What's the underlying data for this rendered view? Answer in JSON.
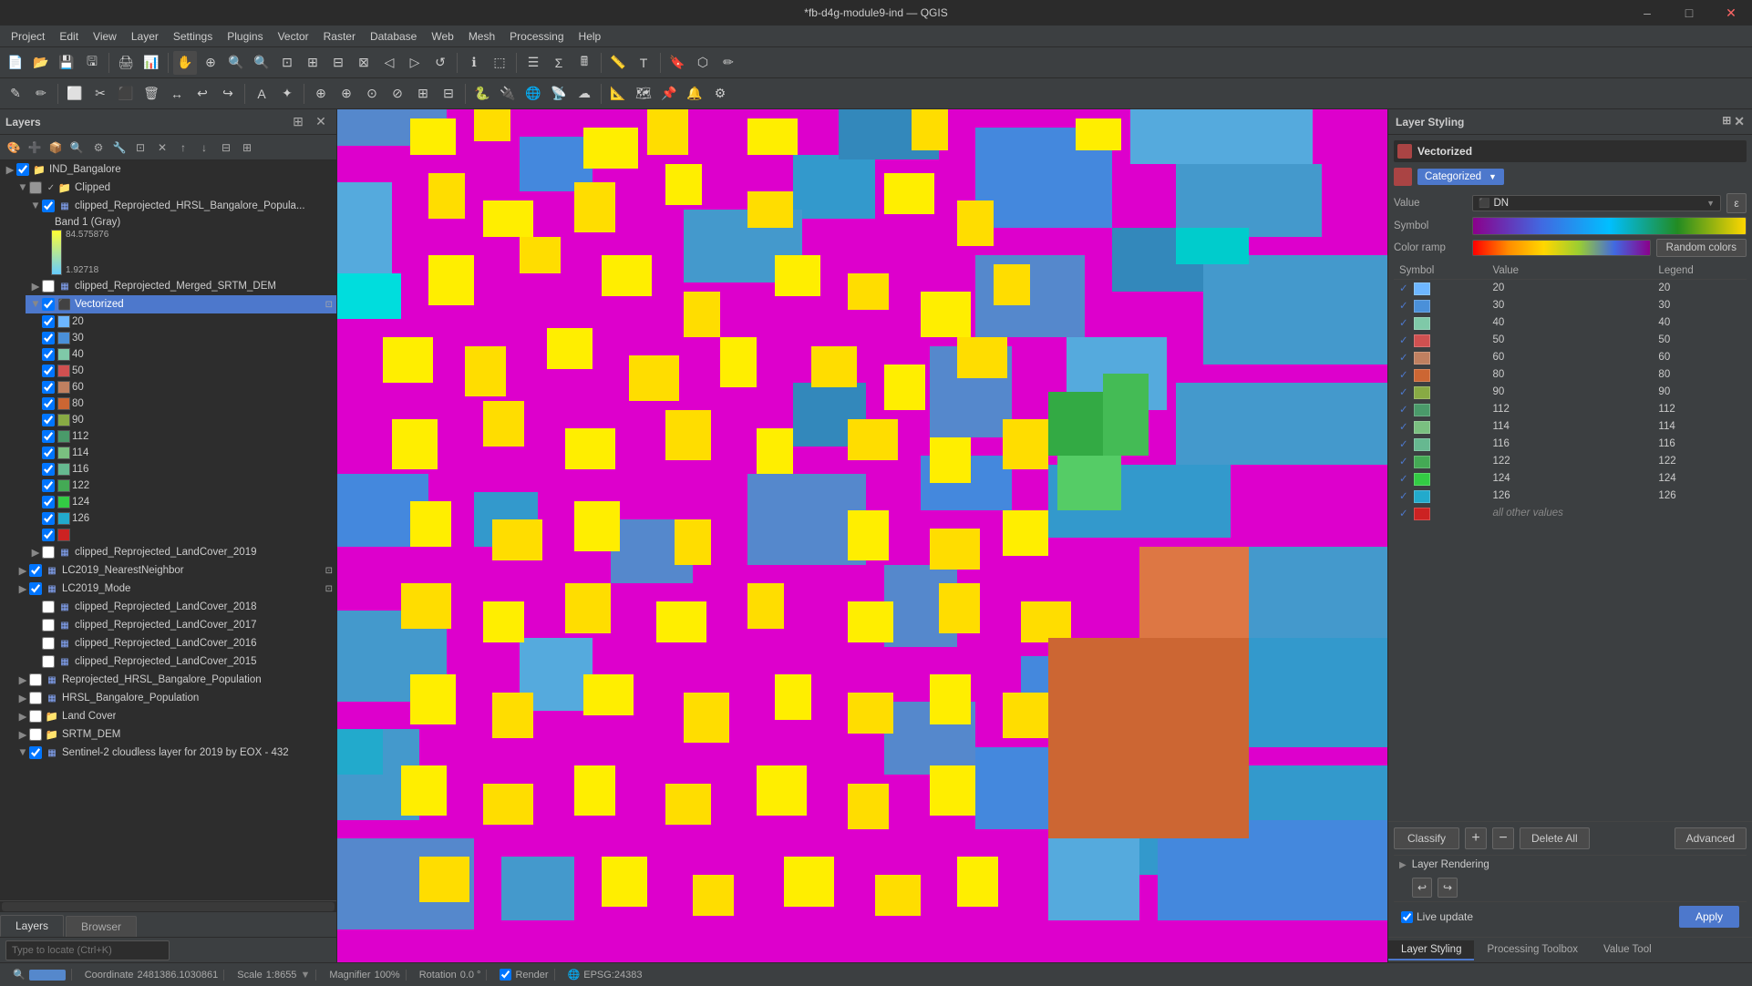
{
  "titlebar": {
    "title": "*fb-d4g-module9-ind — QGIS",
    "min": "–",
    "max": "□",
    "close": "✕"
  },
  "menubar": {
    "items": [
      "Project",
      "Edit",
      "View",
      "Layer",
      "Settings",
      "Plugins",
      "Vector",
      "Raster",
      "Database",
      "Web",
      "Mesh",
      "Processing",
      "Help"
    ]
  },
  "panels": {
    "layers": "Layers",
    "layer_styling": "Layer Styling"
  },
  "layers_panel": {
    "search_placeholder": "Type to locate (Ctrl+K)"
  },
  "layers": [
    {
      "id": "ind_bangalore",
      "name": "IND_Bangalore",
      "checked": true,
      "indent": 0,
      "type": "group",
      "expanded": false
    },
    {
      "id": "clipped",
      "name": "Clipped",
      "checked": true,
      "indent": 1,
      "type": "group",
      "expanded": true
    },
    {
      "id": "clipped_hrsl",
      "name": "clipped_Reprojected_HRSL_Bangalore_Popula...",
      "checked": true,
      "indent": 2,
      "type": "raster",
      "expanded": true
    },
    {
      "id": "band1",
      "name": "Band 1 (Gray)",
      "checked": false,
      "indent": 3,
      "type": "legend"
    },
    {
      "id": "clipped_srtm",
      "name": "clipped_Reprojected_Merged_SRTM_DEM",
      "checked": false,
      "indent": 2,
      "type": "raster",
      "expanded": false
    },
    {
      "id": "vectorized",
      "name": "Vectorized",
      "checked": true,
      "indent": 2,
      "type": "vector",
      "selected": true
    },
    {
      "id": "val20",
      "name": "20",
      "checked": true,
      "indent": 3,
      "type": "legend_item",
      "color": "#6db6ff"
    },
    {
      "id": "val30",
      "name": "30",
      "checked": true,
      "indent": 3,
      "type": "legend_item",
      "color": "#4a90d9"
    },
    {
      "id": "val40",
      "name": "40",
      "checked": true,
      "indent": 3,
      "type": "legend_item",
      "color": "#7fc9a8"
    },
    {
      "id": "val50",
      "name": "50",
      "checked": true,
      "indent": 3,
      "type": "legend_item",
      "color": "#d05050"
    },
    {
      "id": "val60",
      "name": "60",
      "checked": true,
      "indent": 3,
      "type": "legend_item",
      "color": "#c08060"
    },
    {
      "id": "val80",
      "name": "80",
      "checked": true,
      "indent": 3,
      "type": "legend_item",
      "color": "#cc6633"
    },
    {
      "id": "val90",
      "name": "90",
      "checked": true,
      "indent": 3,
      "type": "legend_item",
      "color": "#88aa44"
    },
    {
      "id": "val112",
      "name": "112",
      "checked": true,
      "indent": 3,
      "type": "legend_item",
      "color": "#4a9a6a"
    },
    {
      "id": "val114",
      "name": "114",
      "checked": true,
      "indent": 3,
      "type": "legend_item",
      "color": "#7ac080"
    },
    {
      "id": "val116",
      "name": "116",
      "checked": true,
      "indent": 3,
      "type": "legend_item",
      "color": "#66b890"
    },
    {
      "id": "val122",
      "name": "122",
      "checked": true,
      "indent": 3,
      "type": "legend_item",
      "color": "#44aa55"
    },
    {
      "id": "val124",
      "name": "124",
      "checked": true,
      "indent": 3,
      "type": "legend_item",
      "color": "#33cc44"
    },
    {
      "id": "val126",
      "name": "126",
      "checked": true,
      "indent": 3,
      "type": "legend_item",
      "color": "#22aacc"
    },
    {
      "id": "val_other",
      "name": "",
      "checked": true,
      "indent": 3,
      "type": "legend_item",
      "color": "#cc2222"
    },
    {
      "id": "lc2019",
      "name": "clipped_Reprojected_LandCover_2019",
      "checked": false,
      "indent": 2,
      "type": "raster",
      "expanded": false
    },
    {
      "id": "lc2019_nn",
      "name": "LC2019_NearestNeighbor",
      "checked": true,
      "indent": 1,
      "type": "raster",
      "expanded": false
    },
    {
      "id": "lc2019_mode",
      "name": "LC2019_Mode",
      "checked": true,
      "indent": 1,
      "type": "raster",
      "expanded": false
    },
    {
      "id": "lc2018",
      "name": "clipped_Reprojected_LandCover_2018",
      "checked": false,
      "indent": 2,
      "type": "raster"
    },
    {
      "id": "lc2017",
      "name": "clipped_Reprojected_LandCover_2017",
      "checked": false,
      "indent": 2,
      "type": "raster"
    },
    {
      "id": "lc2016",
      "name": "clipped_Reprojected_LandCover_2016",
      "checked": false,
      "indent": 2,
      "type": "raster"
    },
    {
      "id": "lc2015",
      "name": "clipped_Reprojected_LandCover_2015",
      "checked": false,
      "indent": 2,
      "type": "raster"
    },
    {
      "id": "hrsl_pop",
      "name": "Reprojected_HRSL_Bangalore_Population",
      "checked": false,
      "indent": 1,
      "type": "raster"
    },
    {
      "id": "hrsl_bng",
      "name": "HRSL_Bangalore_Population",
      "checked": false,
      "indent": 1,
      "type": "raster"
    },
    {
      "id": "land_cover",
      "name": "Land Cover",
      "checked": false,
      "indent": 1,
      "type": "group"
    },
    {
      "id": "srtm_dem",
      "name": "SRTM_DEM",
      "checked": false,
      "indent": 1,
      "type": "group"
    },
    {
      "id": "sentinel",
      "name": "Sentinel-2 cloudless layer for 2019 by EOX - 432",
      "checked": true,
      "indent": 1,
      "type": "raster"
    }
  ],
  "styling": {
    "layer_name": "Vectorized",
    "renderer": "Categorized",
    "field": "DN",
    "color_ramp_label": "Random colors",
    "columns": [
      "Symbol",
      "Value",
      "Legend"
    ],
    "legend_items": [
      {
        "value": "20",
        "legend": "20",
        "color": "#6db6ff"
      },
      {
        "value": "30",
        "legend": "30",
        "color": "#4a90d9"
      },
      {
        "value": "40",
        "legend": "40",
        "color": "#7fc9a8"
      },
      {
        "value": "50",
        "legend": "50",
        "color": "#d05050"
      },
      {
        "value": "60",
        "legend": "60",
        "color": "#c08060"
      },
      {
        "value": "80",
        "legend": "80",
        "color": "#cc6633"
      },
      {
        "value": "90",
        "legend": "90",
        "color": "#88aa44"
      },
      {
        "value": "112",
        "legend": "112",
        "color": "#4a9a6a"
      },
      {
        "value": "114",
        "legend": "114",
        "color": "#7ac080"
      },
      {
        "value": "116",
        "legend": "116",
        "color": "#66b890"
      },
      {
        "value": "122",
        "legend": "122",
        "color": "#44aa55"
      },
      {
        "value": "124",
        "legend": "124",
        "color": "#33cc44"
      },
      {
        "value": "126",
        "legend": "126",
        "color": "#22aacc"
      },
      {
        "value": "all other values",
        "legend": "",
        "color": "#cc2222"
      }
    ],
    "classify_label": "Classify",
    "delete_all_label": "Delete All",
    "advanced_label": "Advanced",
    "apply_label": "Apply",
    "layer_rendering_label": "Layer Rendering",
    "live_update_label": "Live update"
  },
  "right_tabs": [
    {
      "id": "layer-styling",
      "label": "Layer Styling",
      "active": true
    },
    {
      "id": "processing-toolbox",
      "label": "Processing Toolbox",
      "active": false
    },
    {
      "id": "value-tool",
      "label": "Value Tool",
      "active": false
    }
  ],
  "statusbar": {
    "coordinate_label": "Coordinate",
    "coordinate_value": "2481386.1030861",
    "scale_label": "Scale",
    "scale_value": "1:8655",
    "magnifier_label": "Magnifier",
    "magnifier_value": "100%",
    "rotation_label": "Rotation",
    "rotation_value": "0.0 °",
    "render_label": "Render",
    "epsg_value": "EPSG:24383"
  },
  "bottom_tabs": [
    {
      "id": "layers",
      "label": "Layers",
      "active": true
    },
    {
      "id": "browser",
      "label": "Browser",
      "active": false
    }
  ],
  "raster_scale": {
    "max": "84.575876",
    "min": "1.92718"
  }
}
